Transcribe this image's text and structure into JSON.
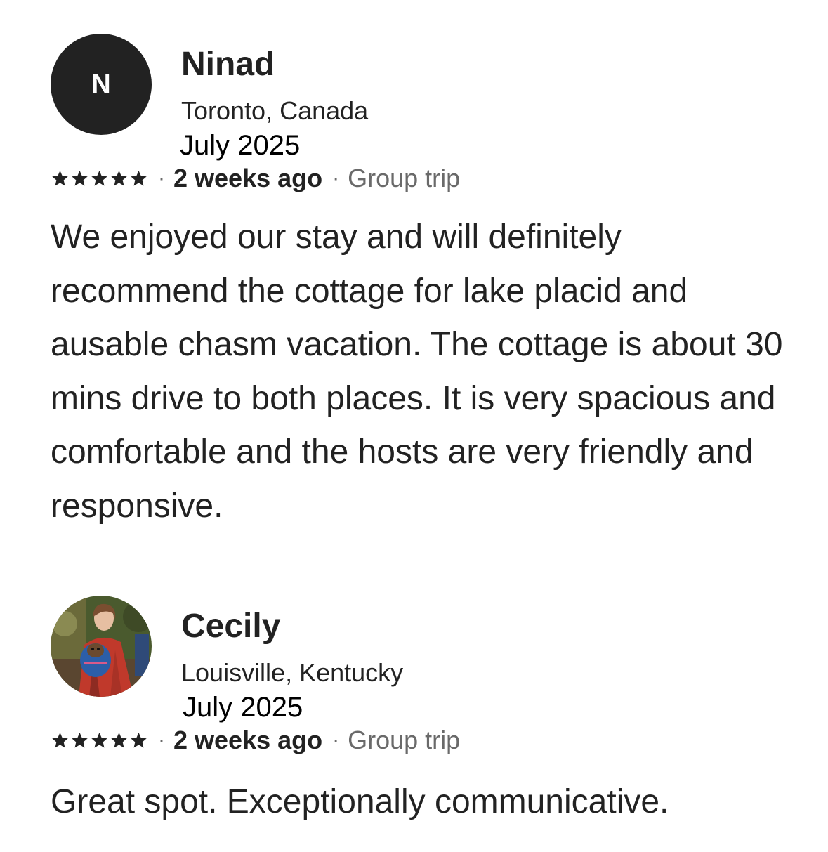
{
  "reviews": [
    {
      "avatar_initial": "N",
      "name": "Ninad",
      "location": "Toronto, Canada",
      "date": "July 2025",
      "rating": 5,
      "separator": "·",
      "time_ago": "2 weeks ago",
      "trip_type": "Group trip",
      "text": "We enjoyed our stay and will definitely recommend the cottage for lake placid and ausable chasm vacation. The cottage is about 30 mins drive to both places. It is very spacious and comfortable and the hosts are very friendly and responsive."
    },
    {
      "avatar_initial": "",
      "name": "Cecily",
      "location": "Louisville, Kentucky",
      "date": "July 2025",
      "rating": 5,
      "separator": "·",
      "time_ago": "2 weeks ago",
      "trip_type": "Group trip",
      "text": "Great spot. Exceptionally communicative."
    }
  ],
  "colors": {
    "text": "#222222",
    "secondary": "#6a6a6a",
    "avatar_bg": "#222222"
  },
  "icons": {
    "star": "star-icon"
  }
}
